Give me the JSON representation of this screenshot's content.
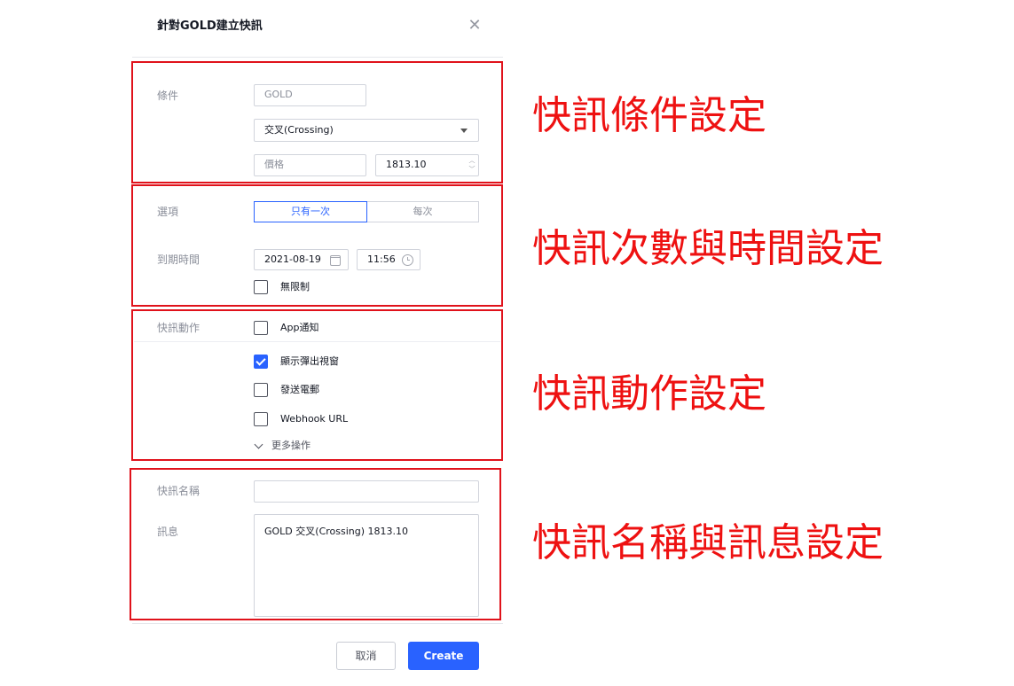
{
  "dialog": {
    "title": "針對GOLD建立快訊"
  },
  "conditions": {
    "label": "條件",
    "symbol": "GOLD",
    "operator": "交叉(Crossing)",
    "target_type_placeholder": "價格",
    "value": "1813.10"
  },
  "options": {
    "label": "選項",
    "frequency": [
      "只有一次",
      "每次"
    ],
    "selected_frequency": "只有一次"
  },
  "expiration": {
    "label": "到期時間",
    "date": "2021-08-19",
    "time": "11:56",
    "unlimited_label": "無限制",
    "unlimited_checked": false
  },
  "actions": {
    "label": "快訊動作",
    "items": [
      {
        "label": "App通知",
        "checked": false
      },
      {
        "label": "顯示彈出視窗",
        "checked": true
      },
      {
        "label": "發送電郵",
        "checked": false
      },
      {
        "label": "Webhook URL",
        "checked": false
      }
    ],
    "more_label": "更多操作"
  },
  "alert_name": {
    "label": "快訊名稱",
    "value": ""
  },
  "message": {
    "label": "訊息",
    "value": "GOLD 交叉(Crossing) 1813.10"
  },
  "buttons": {
    "cancel": "取消",
    "create": "Create"
  },
  "annotations": [
    "快訊條件設定",
    "快訊次數與時間設定",
    "快訊動作設定",
    "快訊名稱與訊息設定"
  ],
  "colors": {
    "accent": "#2962ff",
    "annotation": "#ee1111"
  }
}
